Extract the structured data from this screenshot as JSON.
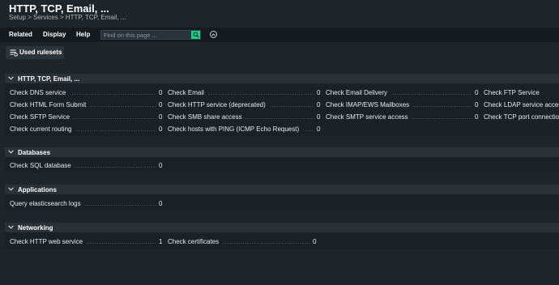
{
  "header": {
    "title": "HTTP, TCP, Email, ...",
    "breadcrumb": "Setup > Services > HTTP, TCP, Email, ..."
  },
  "menubar": {
    "items": [
      "Related",
      "Display",
      "Help"
    ],
    "search_placeholder": "Find on this page ...",
    "search_icon": "search-icon",
    "toggle_icon": "chevron-up-icon"
  },
  "toolbar": {
    "used_rulesets_label": "Used rulesets",
    "used_rulesets_icon": "list-icon"
  },
  "colors": {
    "accent": "#13d389",
    "background": "#1e252b",
    "section_header": "#2a3238"
  },
  "sections": [
    {
      "title": "HTTP, TCP, Email, ...",
      "items": [
        {
          "name": "Check DNS service",
          "count": "0"
        },
        {
          "name": "Check Email",
          "count": "0"
        },
        {
          "name": "Check Email Delivery",
          "count": "0"
        },
        {
          "name": "Check FTP Service",
          "count": ""
        },
        {
          "name": "Check HTML Form Submit",
          "count": "0"
        },
        {
          "name": "Check HTTP service (deprecated)",
          "count": "0"
        },
        {
          "name": "Check IMAP/EWS Mailboxes",
          "count": "0"
        },
        {
          "name": "Check LDAP service access",
          "count": ""
        },
        {
          "name": "Check SFTP Service",
          "count": "0"
        },
        {
          "name": "Check SMB share access",
          "count": "0"
        },
        {
          "name": "Check SMTP service access",
          "count": "0"
        },
        {
          "name": "Check TCP port connection",
          "count": ""
        },
        {
          "name": "Check current routing",
          "count": "0"
        },
        {
          "name": "Check hosts with PING (ICMP Echo Request)",
          "count": "0"
        }
      ]
    },
    {
      "title": "Databases",
      "items": [
        {
          "name": "Check SQL database",
          "count": "0"
        }
      ]
    },
    {
      "title": "Applications",
      "items": [
        {
          "name": "Query elasticsearch logs",
          "count": "0"
        }
      ]
    },
    {
      "title": "Networking",
      "items": [
        {
          "name": "Check HTTP web service",
          "count": "1"
        },
        {
          "name": "Check certificates",
          "count": "0"
        }
      ]
    }
  ]
}
